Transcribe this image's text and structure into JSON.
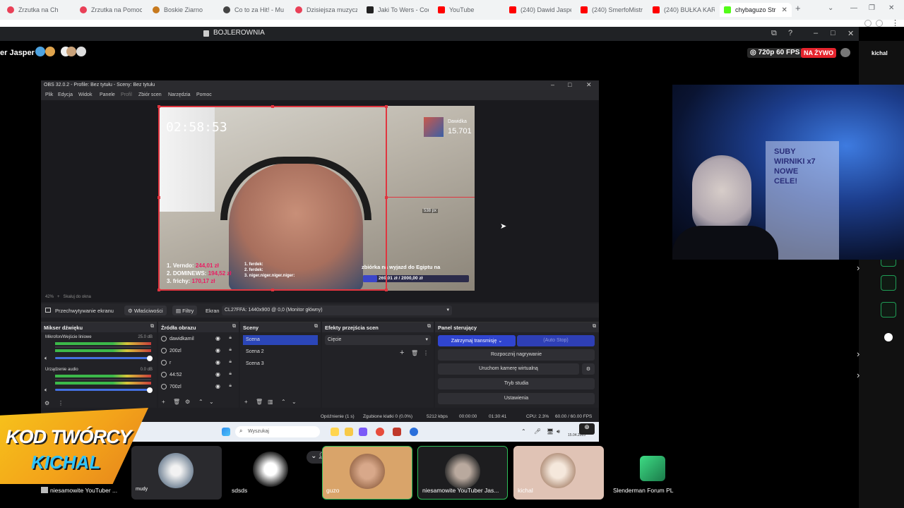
{
  "browser": {
    "tabs": [
      {
        "title": "Zrzutka na Ch",
        "color": "#e94057",
        "active": false
      },
      {
        "title": "Zrzutka na Pomoc",
        "color": "#e94057",
        "active": false
      },
      {
        "title": "Boskie Ziarno",
        "color": "#c77a1e",
        "active": false
      },
      {
        "title": "Co to za Hit! - Mu",
        "color": "#444444",
        "active": false
      },
      {
        "title": "Dzisiejsza muzyczn",
        "color": "#e94057",
        "active": false
      },
      {
        "title": "Jaki To Wers - Cod",
        "color": "#222222",
        "active": false
      },
      {
        "title": "YouTube",
        "color": "#ff0000",
        "active": false
      },
      {
        "title": "(240) Dawid Jasper",
        "color": "#ff0000",
        "active": false
      },
      {
        "title": "(240) SmerfoMistrz",
        "color": "#ff0000",
        "active": false
      },
      {
        "title": "(240) BUŁKA KARU",
        "color": "#ff0000",
        "active": false
      },
      {
        "title": "chybaguzo Str",
        "color": "#53fc18",
        "active": true
      }
    ],
    "new_tab": "+",
    "window_title": "BOJLEROWNIA"
  },
  "stream": {
    "channel_name": "er Jasper",
    "quality": "720p 60 FPS",
    "live": "NA ŻYWO",
    "side_label": "kichal"
  },
  "obs": {
    "title": "OBS 32.0.2 - Profile: Bez tytułu - Sceny: Bez tytułu",
    "menu": [
      "Plik",
      "Edycja",
      "Widok",
      "Panele",
      "Profil",
      "Zbiór scen",
      "Narzędzia",
      "Pomoc"
    ],
    "status_zoom": "42%",
    "status_fit": "Skaluj do okna",
    "screen_capture": "Przechwytywanie ekranu",
    "properties": "Właściwości",
    "filters": "Filtry",
    "screen_label": "Ekran",
    "monitor": "CL27FFA: 1440x900 @ 0,0 (Monitor główny)",
    "preview": {
      "clock": "02:58:53",
      "donor_name": "Dawidka",
      "donor_amount": "15.701",
      "leaderboard": [
        {
          "label": "1. Verndo:",
          "amount": "244,01 zł"
        },
        {
          "label": "2. DOMINEWS:",
          "amount": "194,52 zł"
        },
        {
          "label": "3. frichy:",
          "amount": "170,17 zł"
        }
      ],
      "chat": [
        "1. ferdek:",
        "2. ferdek:",
        "3. niger.niger.niger.niger:"
      ],
      "goal_text": "zbiórka na wyjazd do Egiptu na",
      "goal_value": "269,01 zł / 2000,00 zł",
      "goal_fraction": 0.1345,
      "px_readout": "538 px"
    },
    "mixer": {
      "header": "Mikser dźwięku",
      "channels": [
        {
          "name": "Mikrofon/Wejście liniowe",
          "db": "25.0 dB"
        },
        {
          "name": "Urządzenie audio",
          "db": "0.0 dB"
        }
      ]
    },
    "sources": {
      "header": "Źródła obrazu",
      "items": [
        "dawidkamil",
        "200zl",
        "r",
        "44:52",
        "700zl"
      ]
    },
    "scenes": {
      "header": "Sceny",
      "items": [
        "Scena",
        "Scena 2",
        "Scena 3"
      ]
    },
    "transitions": {
      "header": "Efekty przejścia scen",
      "value": "Cięcie"
    },
    "controls": {
      "header": "Panel sterujący",
      "stop_stream": "Zatrzymaj transmisję",
      "auto_stop": "(Auto Stop)",
      "record": "Rozpocznij nagrywanie",
      "virtual_cam": "Uruchom kamerę wirtualną",
      "studio": "Tryb studia",
      "settings": "Ustawienia"
    },
    "status": {
      "delay": "Opóźnienie (1 s)",
      "dropped": "Zgubione klatki 0 (0.0%)",
      "bitrate": "5212 kbps",
      "rec_time": "00:00:00",
      "stream_time": "01:30:41",
      "cpu": "CPU: 2.3%",
      "fps": "60.00 / 60.00 FPS"
    }
  },
  "taskbar": {
    "search": "Wyszukaj",
    "date": "15.04.2025"
  },
  "webcam": {
    "whiteboard_text": "SUBY\nWIRNIKI x7\nNOWE\nCELE!"
  },
  "creator": {
    "line1": "KOD TWÓRCY",
    "line2": "KICHAL"
  },
  "participants": [
    {
      "name": "niesamowite YouTuber ..."
    },
    {
      "name": "mudy"
    },
    {
      "name": "sdsds"
    },
    {
      "name": "guzo"
    },
    {
      "name": "niesamowite YouTuber Jas..."
    },
    {
      "name": "kichal"
    },
    {
      "name": "Slenderman Forum PL"
    }
  ]
}
